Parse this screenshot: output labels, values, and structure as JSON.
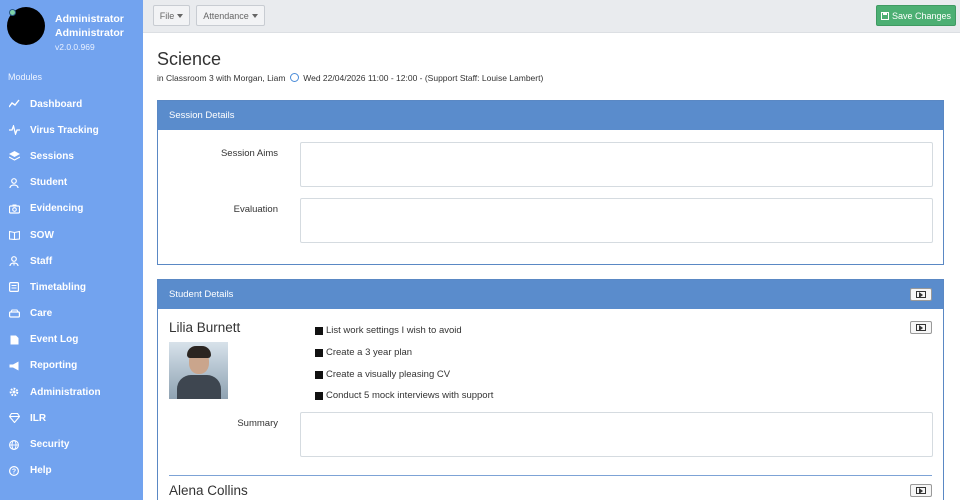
{
  "sidebar": {
    "user_name": "Administrator Administrator",
    "version": "v2.0.0.969",
    "modules_label": "Modules",
    "items": [
      {
        "label": "Dashboard",
        "icon": "chart-line-icon"
      },
      {
        "label": "Virus Tracking",
        "icon": "pulse-icon"
      },
      {
        "label": "Sessions",
        "icon": "layers-icon"
      },
      {
        "label": "Student",
        "icon": "user-icon"
      },
      {
        "label": "Evidencing",
        "icon": "camera-icon"
      },
      {
        "label": "SOW",
        "icon": "book-icon"
      },
      {
        "label": "Staff",
        "icon": "user-tie-icon"
      },
      {
        "label": "Timetabling",
        "icon": "calendar-list-icon"
      },
      {
        "label": "Care",
        "icon": "car-icon"
      },
      {
        "label": "Event Log",
        "icon": "file-icon"
      },
      {
        "label": "Reporting",
        "icon": "megaphone-icon"
      },
      {
        "label": "Administration",
        "icon": "cog-icon"
      },
      {
        "label": "ILR",
        "icon": "diamond-icon"
      },
      {
        "label": "Security",
        "icon": "globe-icon"
      },
      {
        "label": "Help",
        "icon": "question-icon"
      }
    ]
  },
  "toolbar": {
    "file_label": "File",
    "attendance_label": "Attendance",
    "save_label": "Save Changes"
  },
  "page": {
    "title": "Science",
    "subtitle_pre": "in Classroom 3 with Morgan, Liam",
    "subtitle_post": "Wed 22/04/2026 11:00 - 12:00  -  (Support Staff: Louise Lambert)"
  },
  "session_details": {
    "header": "Session Details",
    "aims_label": "Session Aims",
    "aims_value": "",
    "evaluation_label": "Evaluation",
    "evaluation_value": ""
  },
  "student_details": {
    "header": "Student Details",
    "students": [
      {
        "name": "Lilia Burnett",
        "targets": [
          "List work settings I wish to avoid",
          "Create a 3 year plan",
          "Create a visually pleasing CV",
          "Conduct 5 mock interviews with support"
        ],
        "summary_label": "Summary",
        "summary_value": ""
      },
      {
        "name": "Alena Collins"
      }
    ]
  },
  "colors": {
    "sidebar": "#72a3ef",
    "panel_header": "#5a8ccc",
    "save_button": "#4caf73"
  }
}
